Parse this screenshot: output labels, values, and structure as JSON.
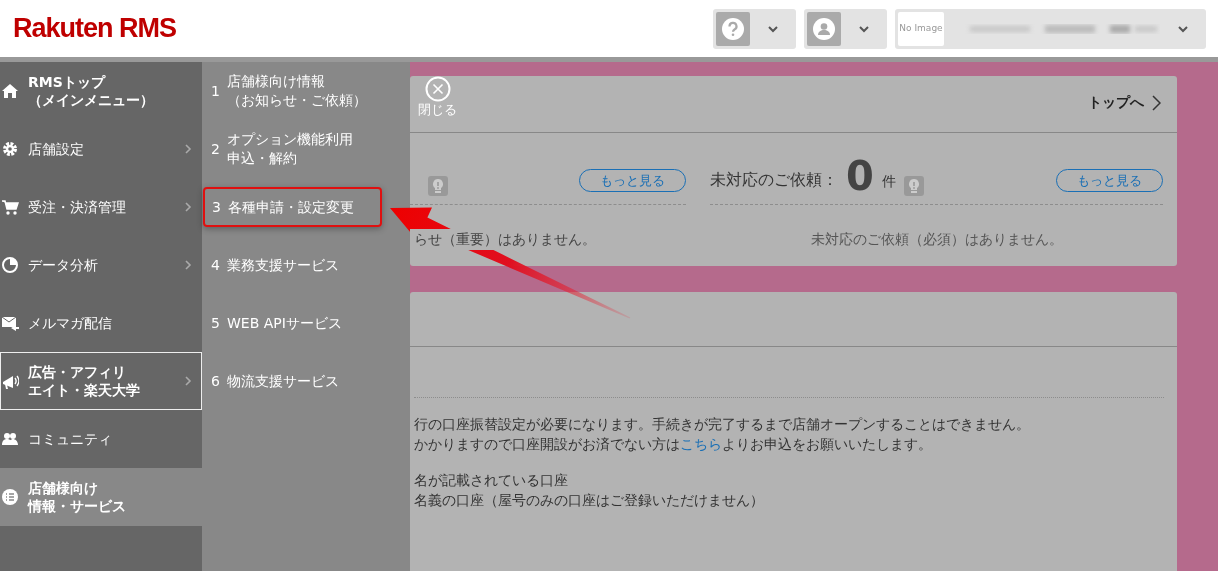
{
  "header": {
    "logo": "Rakuten RMS",
    "shop_thumbnail": "No Image"
  },
  "sidebar": {
    "items": [
      {
        "label_lines": [
          "RMSトップ",
          "（メインメニュー）"
        ],
        "emphasized": true,
        "has_submenu": false,
        "outlined": false,
        "selected": false
      },
      {
        "label_lines": [
          "店舗設定"
        ],
        "emphasized": false,
        "has_submenu": true,
        "outlined": false,
        "selected": false
      },
      {
        "label_lines": [
          "受注・決済管理"
        ],
        "emphasized": false,
        "has_submenu": true,
        "outlined": false,
        "selected": false
      },
      {
        "label_lines": [
          "データ分析"
        ],
        "emphasized": false,
        "has_submenu": true,
        "outlined": false,
        "selected": false
      },
      {
        "label_lines": [
          "メルマガ配信"
        ],
        "emphasized": false,
        "has_submenu": false,
        "outlined": false,
        "selected": false
      },
      {
        "label_lines": [
          "広告・アフィリ",
          "エイト・楽天大学"
        ],
        "emphasized": true,
        "has_submenu": true,
        "outlined": true,
        "selected": false
      },
      {
        "label_lines": [
          "コミュニティ"
        ],
        "emphasized": false,
        "has_submenu": false,
        "outlined": false,
        "selected": false
      },
      {
        "label_lines": [
          "店舗様向け",
          "情報・サービス"
        ],
        "emphasized": true,
        "has_submenu": false,
        "outlined": false,
        "selected": true
      }
    ]
  },
  "submenu": {
    "items": [
      {
        "number": "1",
        "label_lines": [
          "店舗様向け情報",
          "（お知らせ・ご依頼）"
        ],
        "highlighted": false
      },
      {
        "number": "2",
        "label_lines": [
          "オプション機能利用",
          "申込・解約"
        ],
        "highlighted": false
      },
      {
        "number": "3",
        "label_lines": [
          "各種申請・設定変更"
        ],
        "highlighted": true
      },
      {
        "number": "4",
        "label_lines": [
          "業務支援サービス"
        ],
        "highlighted": false
      },
      {
        "number": "5",
        "label_lines": [
          "WEB APIサービス"
        ],
        "highlighted": false
      },
      {
        "number": "6",
        "label_lines": [
          "物流支援サービス"
        ],
        "highlighted": false
      }
    ]
  },
  "notice_card": {
    "close_label": "閉じる",
    "top_link": "トップへ",
    "left": {
      "more_button": "もっと見る",
      "empty_message": "らせ（重要）はありません。"
    },
    "right": {
      "label": "未対応のご依頼：",
      "count": "0",
      "unit": "件",
      "more_button": "もっと見る",
      "empty_message": "未対応のご依頼（必須）はありません。"
    }
  },
  "account_card": {
    "paragraphs": [
      [
        {
          "text": "行の口座振替設定が必要になります。手続きが完了するまで店舗オープンすることはできません。"
        },
        {
          "text": "かかりますので口座開設がお済でない方は",
          "link": "こちら",
          "text_after": "よりお申込をお願いいたします。"
        }
      ],
      [
        {
          "text": "名が記載されている口座"
        },
        {
          "text": "名義の口座（屋号のみの口座はご登録いただけません）"
        }
      ]
    ]
  }
}
